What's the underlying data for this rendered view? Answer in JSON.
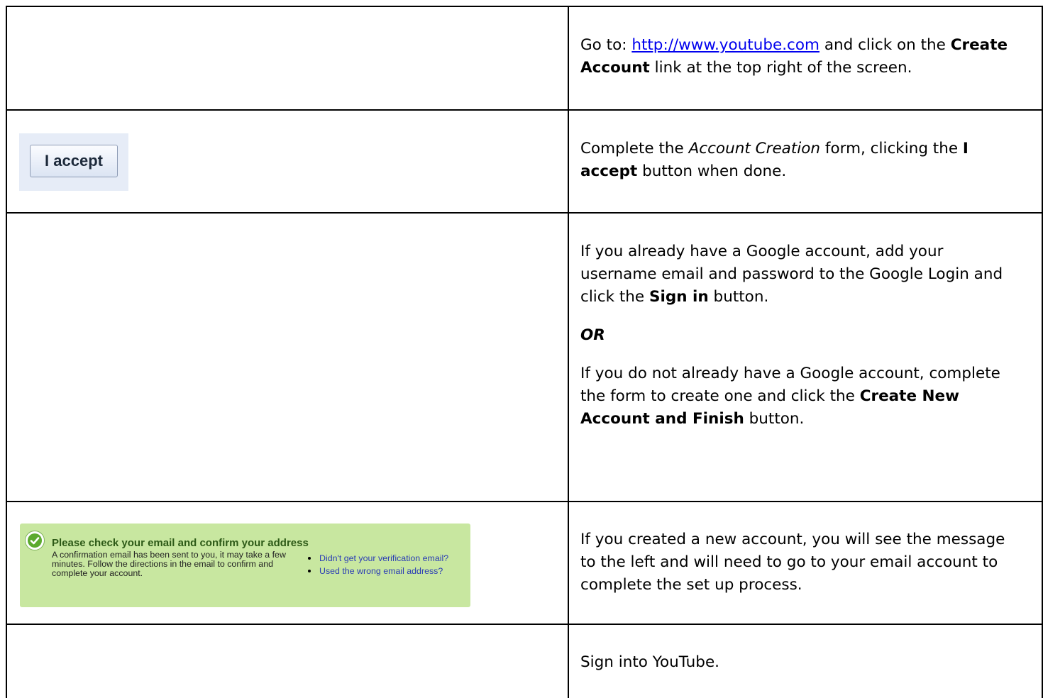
{
  "rows": [
    {
      "pre": "Go to: ",
      "link": "http://www.youtube.com",
      "mid": " and click on the ",
      "bold": "Create Account",
      "post": " link at the top right of the screen."
    },
    {
      "image_button_label": "I accept",
      "pre": "Complete the ",
      "italic": "Account Creation",
      "mid": " form, clicking the ",
      "bold": "I accept",
      "post": " button when done."
    },
    {
      "p1_pre": "If you already have a Google account, add your username email and password to the Google Login and click the ",
      "p1_bold": "Sign in",
      "p1_post": " button.",
      "or": "OR",
      "p2_pre": "If you do not already have a Google account, complete the form to create one and click the ",
      "p2_bold": "Create New Account and Finish",
      "p2_post": " button."
    },
    {
      "confirm": {
        "title": "Please check your email and confirm your address",
        "body": "A confirmation email has been sent to you, it may take a few minutes. Follow the directions in the email to confirm and complete your account.",
        "links": [
          "Didn't get your verification email?",
          "Used the wrong email address?"
        ]
      },
      "text": "If you created a new account, you will see the message to the left and will need to go to your email account to complete the set up process."
    },
    {
      "text": "Sign into YouTube."
    }
  ]
}
